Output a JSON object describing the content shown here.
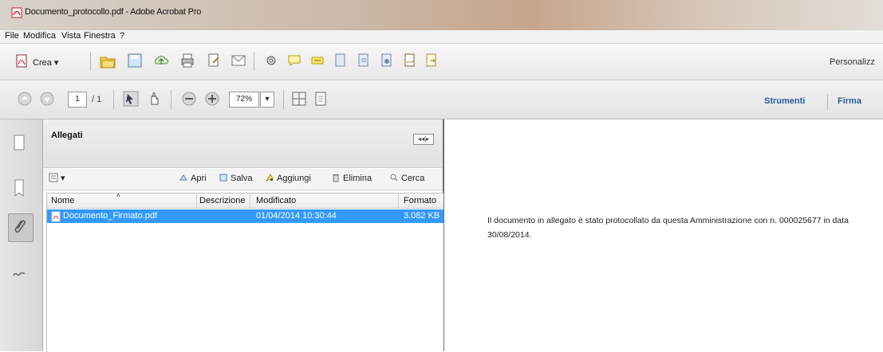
{
  "window": {
    "title": "Documento_protocollo.pdf - Adobe Acrobat Pro"
  },
  "menu": {
    "items": [
      "File",
      "Modifica",
      "Vista",
      "Finestra",
      "?"
    ]
  },
  "toolbar": {
    "create_label": "Crea ▾",
    "customize_label": "Personalizz"
  },
  "navigation": {
    "page_value": "1",
    "page_total": "/ 1",
    "zoom_value": "72%"
  },
  "right_panel": {
    "tools_label": "Strumenti",
    "sign_label": "Firma"
  },
  "attachments_panel": {
    "title": "Allegati",
    "actions": {
      "open": "Apri",
      "save": "Salva",
      "add": "Aggiungi",
      "delete": "Elimina",
      "search": "Cerca"
    },
    "columns": [
      "Nome",
      "Descrizione",
      "Modificato",
      "Formato"
    ],
    "rows": [
      {
        "name": "Documento_Firmato.pdf",
        "description": "",
        "modified": "01/04/2014 10:30:44",
        "format": "3.082 KB"
      }
    ],
    "header_controls": "◂◂|▸"
  },
  "document": {
    "text_line1": "Il documento in allegato è stato protocollato da questa Amministrazione con n. 000025677 in data",
    "text_line2": "30/08/2014."
  },
  "colors": {
    "selection": "#3399ff",
    "link_blue": "#2c5aa0"
  }
}
